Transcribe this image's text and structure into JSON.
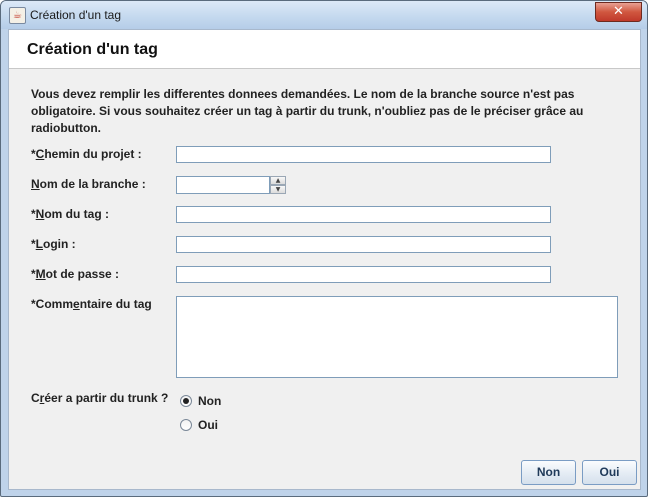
{
  "window": {
    "title": "Création d'un tag",
    "close_glyph": "✕",
    "app_icon": "java-icon"
  },
  "header": {
    "title": "Création d'un tag"
  },
  "intro": "Vous devez remplir les differentes donnees demandées. Le nom de la branche source n'est pas obligatoire. Si vous souhaitez créer un tag à partir du trunk, n'oubliez pas de le préciser grâce au radiobutton.",
  "fields": {
    "chemin": {
      "pre": "*",
      "mnemonic": "C",
      "post": "hemin du projet :",
      "value": ""
    },
    "branche": {
      "pre": "",
      "mnemonic": "N",
      "post": "om de la branche :",
      "value": ""
    },
    "tag": {
      "pre": "*",
      "mnemonic": "N",
      "post": "om du tag :",
      "value": ""
    },
    "login": {
      "pre": "*",
      "mnemonic": "L",
      "post": "ogin :",
      "value": ""
    },
    "password": {
      "pre": "*",
      "mnemonic": "M",
      "post": "ot de passe :",
      "value": ""
    },
    "commentaire": {
      "pre": "*Comm",
      "mnemonic": "e",
      "post": "ntaire du tag",
      "value": ""
    }
  },
  "trunk": {
    "label_pre": "C",
    "label_mnemonic": "r",
    "label_post": "éer a partir du trunk ?",
    "options": [
      {
        "label": "Non",
        "checked": true
      },
      {
        "label": "Oui",
        "checked": false
      }
    ]
  },
  "buttons": {
    "non": "Non",
    "oui": "Oui"
  }
}
